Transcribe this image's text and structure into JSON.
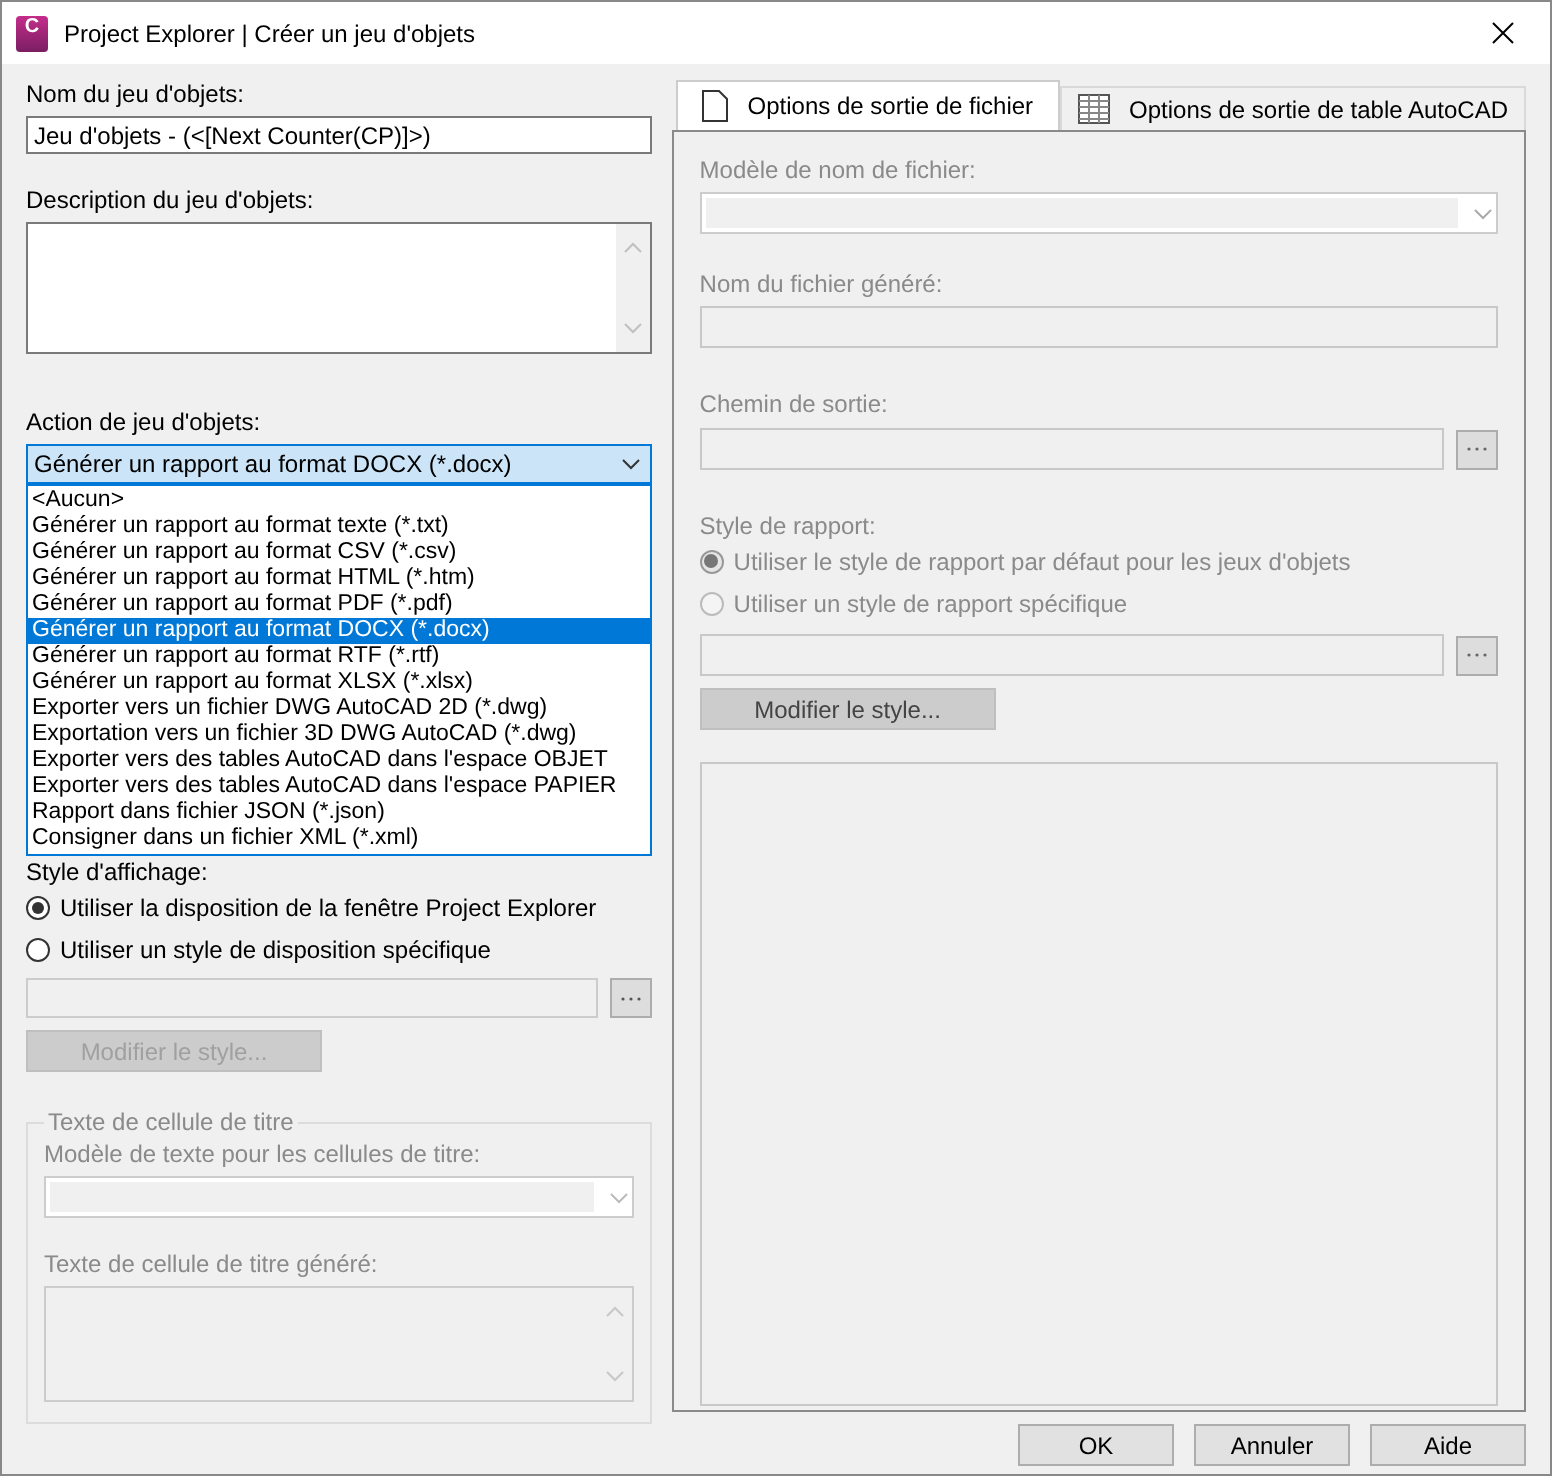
{
  "window": {
    "title": "Project Explorer | Créer un jeu d'objets",
    "app_icon_letter": "C"
  },
  "left": {
    "name_label": "Nom du jeu d'objets:",
    "name_value": "Jeu d'objets - (<[Next Counter(CP)]>)",
    "description_label": "Description du jeu d'objets:",
    "action_label": "Action de jeu d'objets:",
    "action_select": {
      "value": "Générer un rapport au format DOCX (*.docx)",
      "expanded": true
    },
    "action_options": [
      {
        "label": "<Aucun>",
        "selected": false
      },
      {
        "label": "Générer un rapport au format texte (*.txt)",
        "selected": false
      },
      {
        "label": "Générer un rapport au format CSV (*.csv)",
        "selected": false
      },
      {
        "label": "Générer un rapport au format HTML (*.htm)",
        "selected": false
      },
      {
        "label": "Générer un rapport au format PDF (*.pdf)",
        "selected": false
      },
      {
        "label": "Générer un rapport au format DOCX (*.docx)",
        "selected": true
      },
      {
        "label": "Générer un rapport au format RTF (*.rtf)",
        "selected": false
      },
      {
        "label": "Générer un rapport au format XLSX (*.xlsx)",
        "selected": false
      },
      {
        "label": "Exporter vers un fichier DWG AutoCAD 2D (*.dwg)",
        "selected": false
      },
      {
        "label": "Exportation vers un fichier 3D DWG AutoCAD (*.dwg)",
        "selected": false
      },
      {
        "label": "Exporter vers des tables AutoCAD dans l'espace OBJET",
        "selected": false
      },
      {
        "label": "Exporter vers des tables AutoCAD dans l'espace PAPIER",
        "selected": false
      },
      {
        "label": "Rapport dans fichier JSON (*.json)",
        "selected": false
      },
      {
        "label": "Consigner dans un fichier XML (*.xml)",
        "selected": false
      }
    ],
    "display_style_label": "Style d'affichage:",
    "display_radios": [
      {
        "label": "Utiliser la disposition de la fenêtre Project Explorer",
        "selected": true,
        "disabled": false
      },
      {
        "label": "Utiliser un style de disposition spécifique",
        "selected": false,
        "disabled": false
      }
    ],
    "layout_style_field": {
      "disabled": true
    },
    "edit_style_button": {
      "label": "Modifier le style...",
      "disabled": true
    },
    "title_cell_group": {
      "legend": "Texte de cellule de titre",
      "template_label": "Modèle de texte pour les cellules de titre:",
      "generated_label": "Texte de cellule de titre généré:",
      "disabled": true
    }
  },
  "right": {
    "tabs": [
      {
        "label": "Options de sortie de fichier",
        "selected": true,
        "kind": "file"
      },
      {
        "label": "Options de sortie de table AutoCAD",
        "selected": false,
        "kind": "table"
      }
    ],
    "disabled": true,
    "filename_template_label": "Modèle de nom de fichier:",
    "generated_filename_label": "Nom du fichier généré:",
    "output_path_label": "Chemin de sortie:",
    "report_style_label": "Style de rapport:",
    "report_radios": [
      {
        "label": "Utiliser le style de rapport par défaut pour les jeux d'objets",
        "selected": true
      },
      {
        "label": "Utiliser un style de rapport spécifique",
        "selected": false
      }
    ],
    "edit_style_button": {
      "label": "Modifier le style..."
    }
  },
  "buttons": [
    "OK",
    "Annuler",
    "Aide"
  ]
}
